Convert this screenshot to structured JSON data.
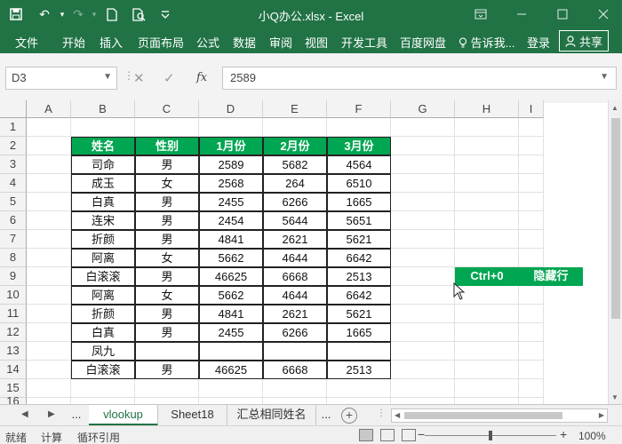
{
  "window": {
    "title": "小Q办公.xlsx - Excel"
  },
  "ribbon": {
    "tabs": [
      "文件",
      "开始",
      "插入",
      "页面布局",
      "公式",
      "数据",
      "审阅",
      "视图",
      "开发工具",
      "百度网盘"
    ],
    "tell_me": "告诉我...",
    "login": "登录",
    "share": "共享"
  },
  "formula_bar": {
    "name_box": "D3",
    "fx_label": "fx",
    "formula": "2589"
  },
  "grid": {
    "columns": [
      "A",
      "B",
      "C",
      "D",
      "E",
      "F",
      "G",
      "H",
      "I"
    ],
    "rows": [
      "1",
      "2",
      "3",
      "4",
      "5",
      "6",
      "7",
      "8",
      "9",
      "10",
      "11",
      "12",
      "13",
      "14",
      "15",
      "16"
    ],
    "table_headers": [
      "姓名",
      "性别",
      "1月份",
      "2月份",
      "3月份"
    ],
    "table_rows": [
      [
        "司命",
        "男",
        "2589",
        "5682",
        "4564"
      ],
      [
        "成玉",
        "女",
        "2568",
        "264",
        "6510"
      ],
      [
        "白真",
        "男",
        "2455",
        "6266",
        "1665"
      ],
      [
        "连宋",
        "男",
        "2454",
        "5644",
        "5651"
      ],
      [
        "折颜",
        "男",
        "4841",
        "2621",
        "5621"
      ],
      [
        "阿离",
        "女",
        "5662",
        "4644",
        "6642"
      ],
      [
        "白滚滚",
        "男",
        "46625",
        "6668",
        "2513"
      ],
      [
        "阿离",
        "女",
        "5662",
        "4644",
        "6642"
      ],
      [
        "折颜",
        "男",
        "4841",
        "2621",
        "5621"
      ],
      [
        "白真",
        "男",
        "2455",
        "6266",
        "1665"
      ],
      [
        "凤九",
        "",
        "",
        "",
        ""
      ],
      [
        "白滚滚",
        "男",
        "46625",
        "6668",
        "2513"
      ]
    ],
    "shortcut_tag": {
      "key": "Ctrl+0",
      "action": "隐藏行"
    }
  },
  "sheets": {
    "ellipsis": "...",
    "tabs": [
      "vlookup",
      "Sheet18",
      "汇总相同姓名"
    ],
    "active": "vlookup",
    "more": "..."
  },
  "status": {
    "ready": "就绪",
    "calculate": "计算",
    "circular": "循环引用",
    "zoom": "100%"
  },
  "colors": {
    "excel_green": "#217346",
    "header_green": "#00a651"
  }
}
